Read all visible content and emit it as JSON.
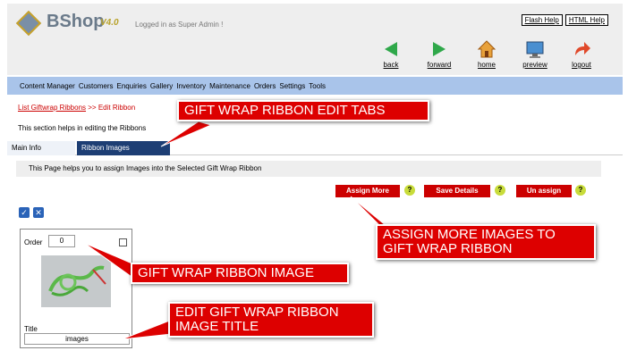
{
  "header": {
    "brand": "BShop",
    "version": "V4.0",
    "logged_in": "Logged in as Super Admin !",
    "flash_help": "Flash Help",
    "html_help": "HTML Help"
  },
  "nav": {
    "back": "back",
    "forward": "forward",
    "home": "home",
    "preview": "preview",
    "logout": "logout"
  },
  "menu": [
    "Content Manager",
    "Customers",
    "Enquiries",
    "Gallery",
    "Inventory",
    "Maintenance",
    "Orders",
    "Settings",
    "Tools"
  ],
  "breadcrumb": {
    "link": "List Giftwrap Ribbons",
    "sep": " >> ",
    "current": "Edit Ribbon"
  },
  "section_help": "This section helps in editing the Ribbons",
  "tabs": {
    "main_info": "Main Info",
    "ribbon_images": "Ribbon Images"
  },
  "info_text": "This Page helps you to assign Images into the Selected Gift Wrap Ribbon",
  "buttons": {
    "assign_more": "Assign More",
    "save_details": "Save Details",
    "un_assign": "Un assign",
    "help_glyph": "?"
  },
  "image_card": {
    "order_label": "Order",
    "order_value": "0",
    "title_label": "Title",
    "title_value": "images"
  },
  "callouts": {
    "tabs": "GIFT WRAP RIBBON EDIT TABS",
    "assign": "ASSIGN MORE IMAGES TO GIFT WRAP RIBBON",
    "image": "GIFT WRAP RIBBON IMAGE",
    "title": "EDIT GIFT WRAP RIBBON IMAGE TITLE"
  },
  "colors": {
    "menu_bg": "#a9c4ea",
    "callout_red": "#dd0000",
    "active_tab": "#1d3e74",
    "button_red": "#cc0000",
    "help_green": "#c8dc3a"
  }
}
